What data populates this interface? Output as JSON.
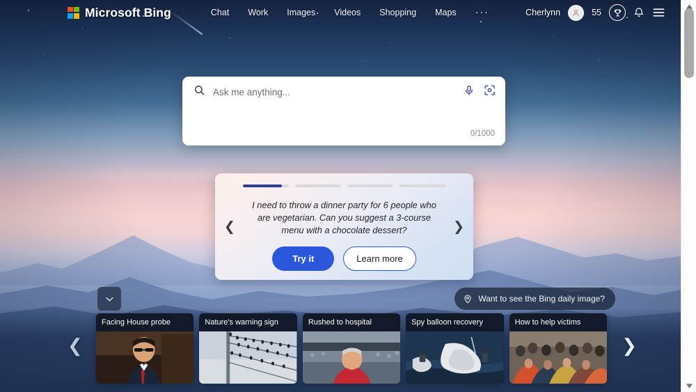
{
  "header": {
    "brand": "Microsoft Bing",
    "logo_colors": [
      "#f25022",
      "#7fba00",
      "#00a4ef",
      "#ffb900"
    ],
    "nav": [
      {
        "label": "Chat",
        "name": "nav-chat"
      },
      {
        "label": "Work",
        "name": "nav-work"
      },
      {
        "label": "Images",
        "name": "nav-images"
      },
      {
        "label": "Videos",
        "name": "nav-videos"
      },
      {
        "label": "Shopping",
        "name": "nav-shopping"
      },
      {
        "label": "Maps",
        "name": "nav-maps"
      }
    ],
    "more_label": "···",
    "user_name": "Cherlynn",
    "points": "55",
    "icons": [
      "avatar-icon",
      "rewards-trophy-icon",
      "notification-bell-icon",
      "hamburger-menu-icon"
    ]
  },
  "search": {
    "placeholder": "Ask me anything...",
    "value": "",
    "counter": "0/1000",
    "icons": [
      "search-icon",
      "microphone-icon",
      "visual-search-icon"
    ]
  },
  "suggestion": {
    "text": "I need to throw a dinner party for 6 people who are vegetarian. Can you suggest a 3-course menu with a chocolate dessert?",
    "try_label": "Try it",
    "learn_label": "Learn more",
    "prev_icon": "chevron-left-icon",
    "next_icon": "chevron-right-icon",
    "progress": [
      85,
      0,
      0,
      0
    ],
    "active_index": 0,
    "accent_color": "#2c3f9e",
    "primary_button_color": "#2b57dd"
  },
  "daily_image": {
    "label": "Want to see the Bing daily image?",
    "icon": "location-pin-icon"
  },
  "collapse": {
    "icon": "chevron-down-icon"
  },
  "news": {
    "prev_icon": "chevron-left-icon",
    "next_icon": "chevron-right-icon",
    "cards": [
      {
        "title": "Facing House probe"
      },
      {
        "title": "Nature's warning sign"
      },
      {
        "title": "Rushed to hospital"
      },
      {
        "title": "Spy balloon recovery"
      },
      {
        "title": "How to help victims"
      }
    ]
  },
  "scrollbar": {
    "up_icon": "scroll-up-arrow-icon",
    "down_icon": "scroll-down-arrow-icon",
    "thumb": "scrollbar-thumb"
  }
}
